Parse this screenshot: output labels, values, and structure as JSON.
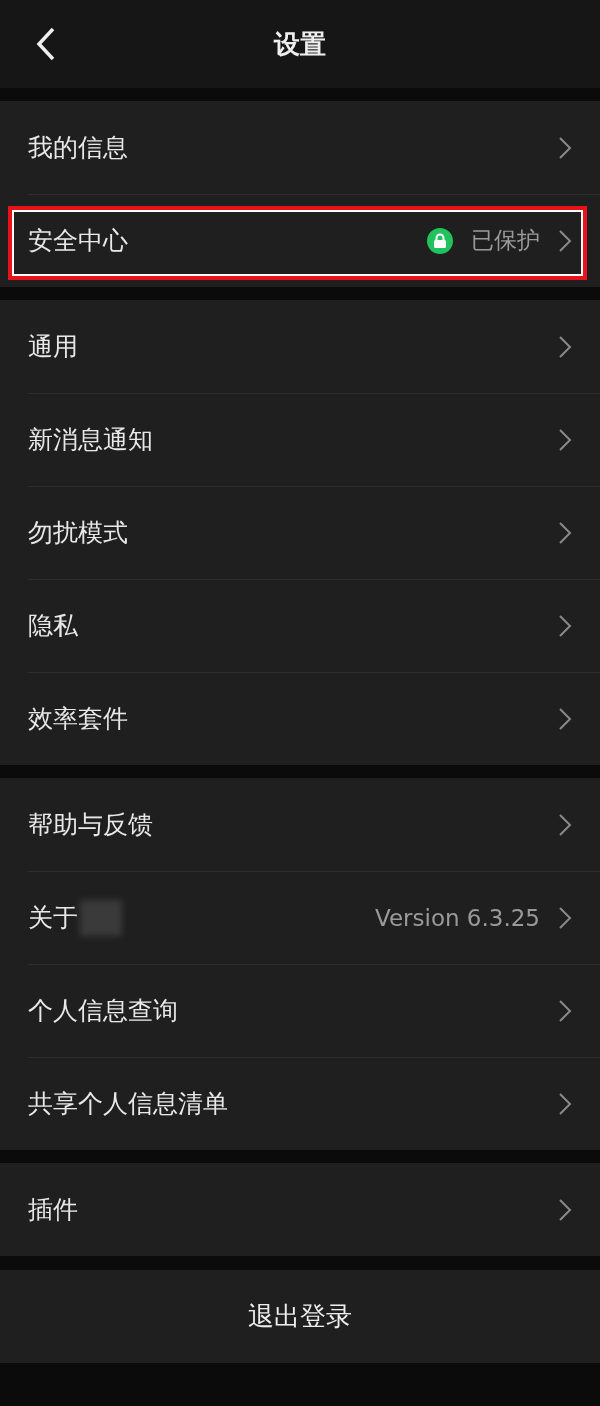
{
  "header": {
    "title": "设置"
  },
  "groups": [
    {
      "items": [
        {
          "label": "我的信息"
        },
        {
          "label": "安全中心",
          "status": "已保护",
          "lock": true,
          "highlighted": true
        }
      ]
    },
    {
      "items": [
        {
          "label": "通用"
        },
        {
          "label": "新消息通知"
        },
        {
          "label": "勿扰模式"
        },
        {
          "label": "隐私"
        },
        {
          "label": "效率套件"
        }
      ]
    },
    {
      "items": [
        {
          "label": "帮助与反馈"
        },
        {
          "label": "关于",
          "redacted": true,
          "status": "Version 6.3.25"
        },
        {
          "label": "个人信息查询"
        },
        {
          "label": "共享个人信息清单"
        }
      ]
    },
    {
      "items": [
        {
          "label": "插件"
        }
      ]
    }
  ],
  "logout": "退出登录"
}
